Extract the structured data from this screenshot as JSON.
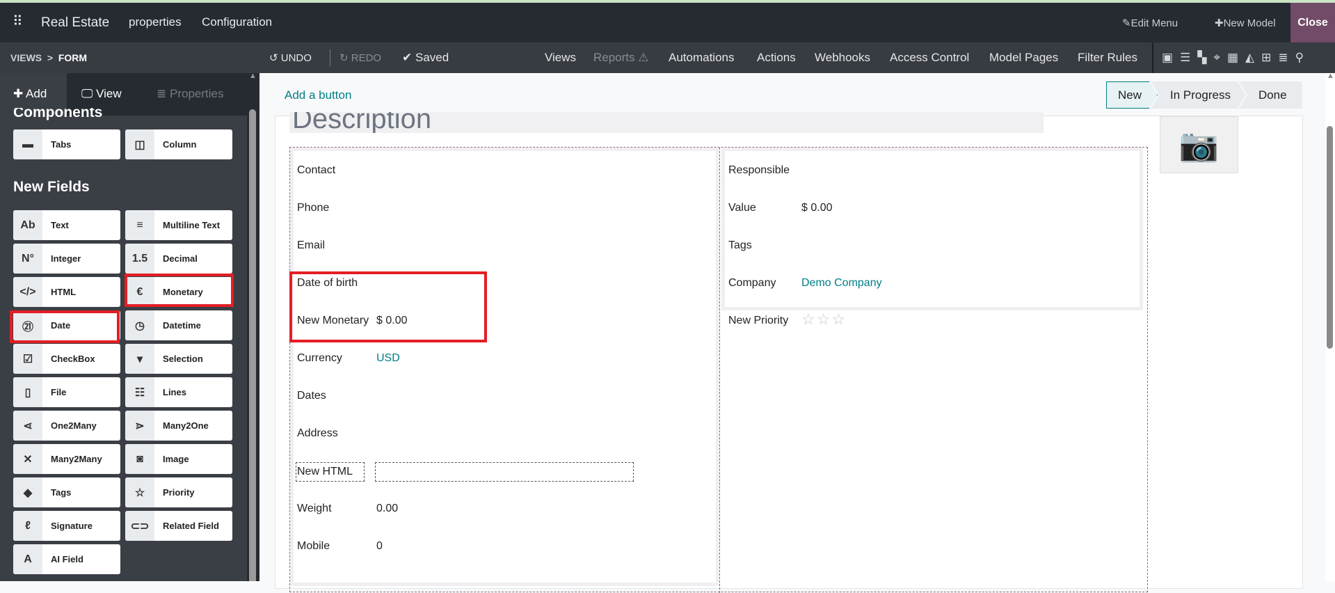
{
  "navbar": {
    "app": "Real Estate",
    "menus": [
      "properties",
      "Configuration"
    ],
    "edit_menu": "Edit Menu",
    "new_model": "New Model",
    "close": "Close"
  },
  "subbar": {
    "breadcrumb": [
      "VIEWS",
      "FORM"
    ],
    "undo": "UNDO",
    "redo": "REDO",
    "saved": "Saved",
    "menus": [
      "Views",
      "Reports",
      "Automations",
      "Actions",
      "Webhooks",
      "Access Control",
      "Model Pages",
      "Filter Rules"
    ]
  },
  "sidebar": {
    "tabs": [
      "Add",
      "View",
      "Properties"
    ],
    "components_heading": "Components",
    "components": [
      "Tabs",
      "Column"
    ],
    "new_fields_heading": "New Fields",
    "fields": [
      "Text",
      "Multiline Text",
      "Integer",
      "Decimal",
      "HTML",
      "Monetary",
      "Date",
      "Datetime",
      "CheckBox",
      "Selection",
      "File",
      "Lines",
      "One2Many",
      "Many2One",
      "Many2Many",
      "Image",
      "Tags",
      "Priority",
      "Signature",
      "Related Field",
      "AI Field"
    ]
  },
  "main": {
    "add_button": "Add a button",
    "statusbar": [
      "New",
      "In Progress",
      "Done"
    ],
    "title_placeholder": "Description",
    "left_fields": [
      {
        "label": "Contact",
        "value": ""
      },
      {
        "label": "Phone",
        "value": ""
      },
      {
        "label": "Email",
        "value": ""
      },
      {
        "label": "Date of birth",
        "value": ""
      },
      {
        "label": "New Monetary",
        "value": "$ 0.00"
      },
      {
        "label": "Currency",
        "value": "USD"
      },
      {
        "label": "Dates",
        "value": ""
      },
      {
        "label": "Address",
        "value": ""
      },
      {
        "label": "New HTML",
        "value": ""
      },
      {
        "label": "Weight",
        "value": "0.00"
      },
      {
        "label": "Mobile",
        "value": "0"
      }
    ],
    "right_fields": [
      {
        "label": "Responsible",
        "value": ""
      },
      {
        "label": "Value",
        "value": "$ 0.00"
      },
      {
        "label": "Tags",
        "value": ""
      },
      {
        "label": "Company",
        "value": "Demo Company"
      },
      {
        "label": "New Priority",
        "value": ""
      }
    ],
    "priority_stars": {
      "filled": 0,
      "total": 3
    }
  },
  "colors": {
    "accent": "#017e84",
    "close": "#714b67",
    "highlight": "#e31e24"
  }
}
